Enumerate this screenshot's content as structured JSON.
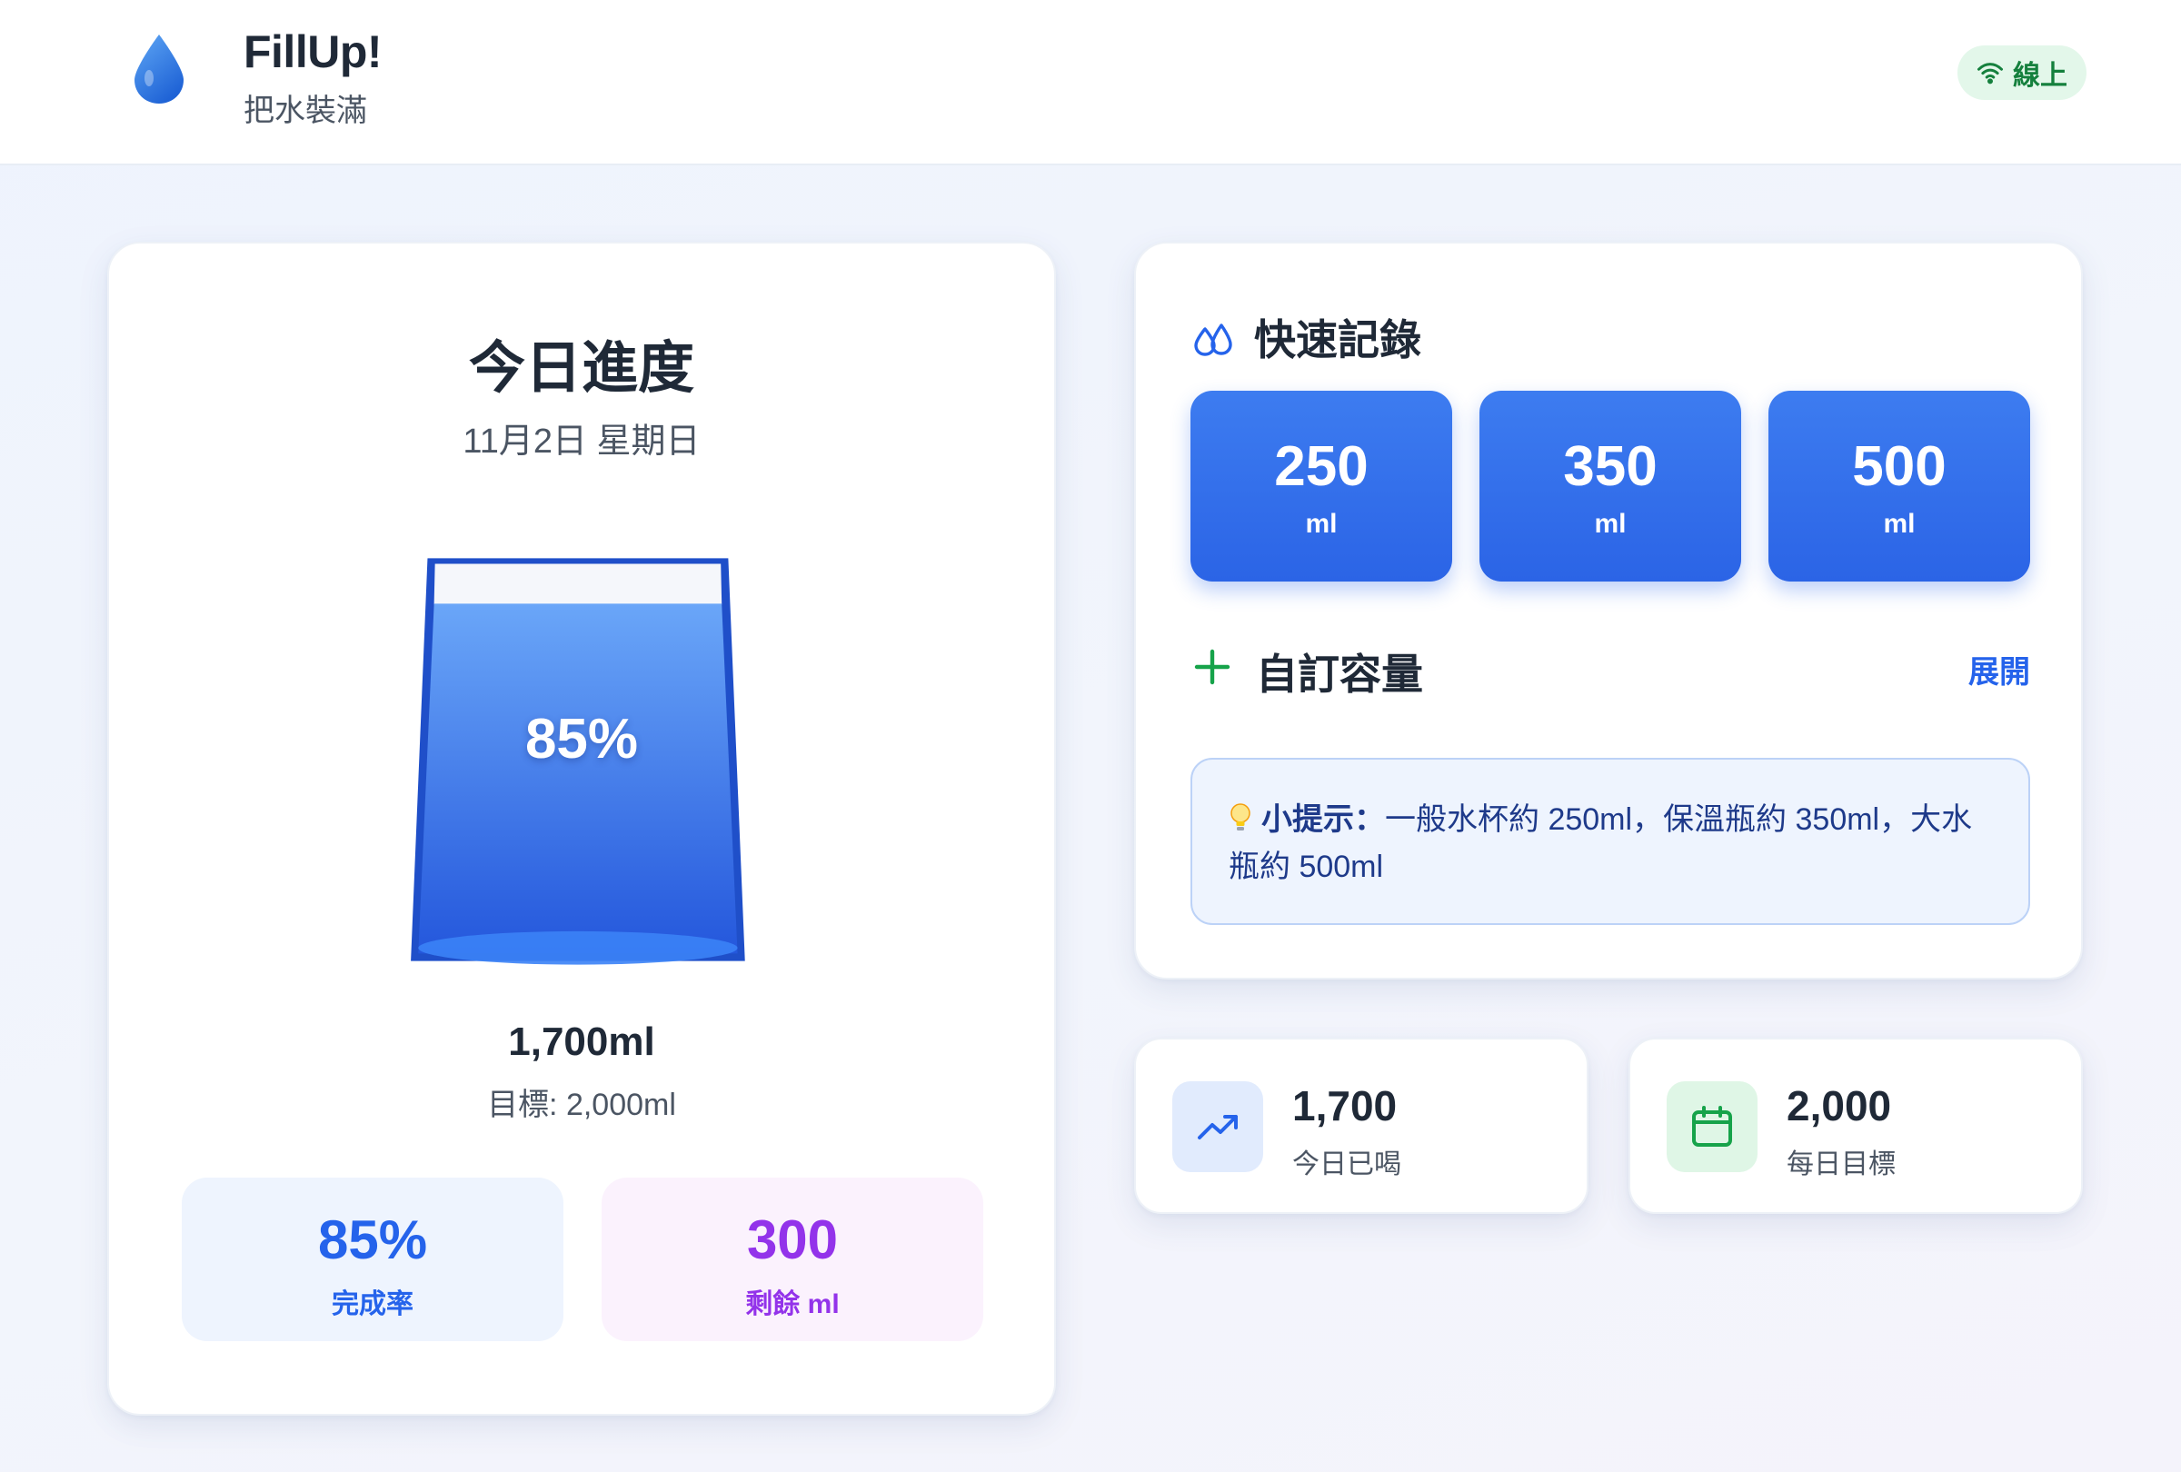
{
  "header": {
    "app_title": "FillUp!",
    "app_subtitle": "把水裝滿",
    "status_label": "線上"
  },
  "progress": {
    "title": "今日進度",
    "date": "11月2日 星期日",
    "cup_percent_label": "85%",
    "fill_fraction": 0.85,
    "amount": "1,700ml",
    "goal": "目標: 2,000ml",
    "rate_value": "85%",
    "rate_label": "完成率",
    "remaining_value": "300",
    "remaining_label": "剩餘 ml"
  },
  "quick_record": {
    "title": "快速記錄",
    "buttons": [
      {
        "value": "250",
        "unit": "ml"
      },
      {
        "value": "350",
        "unit": "ml"
      },
      {
        "value": "500",
        "unit": "ml"
      }
    ],
    "custom_label": "自訂容量",
    "expand_label": "展開",
    "tip_heading": "小提示：",
    "tip_text": "一般水杯約 250ml，保溫瓶約 350ml，大水瓶約 500ml"
  },
  "stats": {
    "drunk_value": "1,700",
    "drunk_label": "今日已喝",
    "goal_value": "2,000",
    "goal_label": "每日目標"
  },
  "colors": {
    "accent_blue": "#2b64e6",
    "status_green": "#15803d",
    "remaining_purple": "#9333ea"
  },
  "icons": {
    "logo": "water-drop-icon",
    "status": "wifi-icon",
    "quick_record": "water-drops-icon",
    "custom": "plus-icon",
    "tip": "lightbulb-icon",
    "drunk": "trending-up-icon",
    "goal": "calendar-icon"
  }
}
